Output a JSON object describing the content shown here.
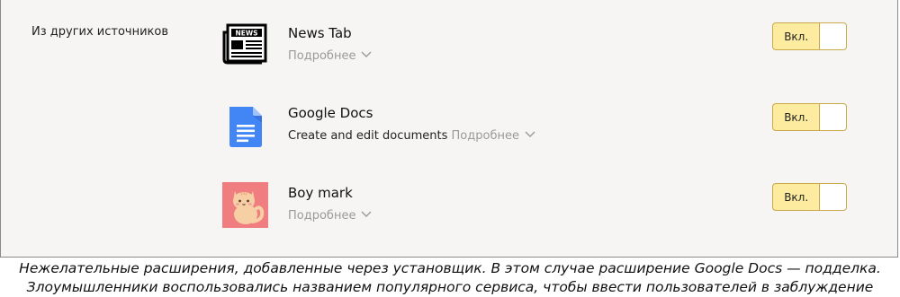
{
  "section": {
    "label": "Из других источников"
  },
  "extensions": [
    {
      "name": "News Tab",
      "description": "",
      "more_label": "Подробнее",
      "toggle_label": "Вкл.",
      "icon": "newspaper-icon",
      "enabled": true
    },
    {
      "name": "Google Docs",
      "description": "Create and edit documents",
      "more_label": "Подробнее",
      "toggle_label": "Вкл.",
      "icon": "google-docs-icon",
      "enabled": true
    },
    {
      "name": "Boy mark",
      "description": "",
      "more_label": "Подробнее",
      "toggle_label": "Вкл.",
      "icon": "cat-icon",
      "enabled": true
    }
  ],
  "caption": {
    "line1": "Нежелательные расширения, добавленные через установщик. В этом случае расширение Google Docs — подделка.",
    "line2": "Злоумышленники воспользовались названием популярного сервиса, чтобы ввести пользователей в заблуждение"
  },
  "colors": {
    "panel_bg": "#f6f5f3",
    "toggle_bg": "#fdeca0",
    "toggle_border": "#c9a94a",
    "link_gray": "#9a9a9a",
    "docs_blue": "#4285f4",
    "cat_bg": "#f07e80"
  }
}
